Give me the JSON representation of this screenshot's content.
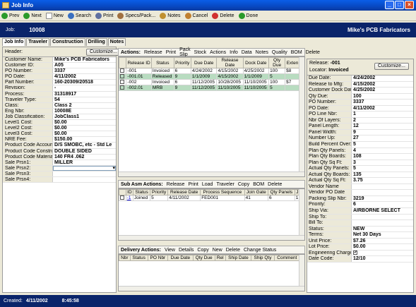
{
  "window": {
    "title": "Job Info"
  },
  "toolbar": [
    {
      "label": "Prev",
      "icon": "prev-icon",
      "color": "#2a9a2a"
    },
    {
      "label": "Next",
      "icon": "next-icon",
      "color": "#2a9a2a"
    },
    {
      "label": "New",
      "icon": "new-icon",
      "color": "#ffffff"
    },
    {
      "label": "Search",
      "icon": "search-icon",
      "color": "#3a70c0"
    },
    {
      "label": "Print",
      "icon": "print-icon",
      "color": "#6070a0"
    },
    {
      "label": "Specs/Pack...",
      "icon": "specs-icon",
      "color": "#a07040"
    },
    {
      "label": "Notes",
      "icon": "notes-icon",
      "color": "#c09030"
    },
    {
      "label": "Cancel",
      "icon": "cancel-icon",
      "color": "#c08030"
    },
    {
      "label": "Delete",
      "icon": "delete-icon",
      "color": "#d03030"
    },
    {
      "label": "Done",
      "icon": "done-icon",
      "color": "#2a9a2a"
    }
  ],
  "job": {
    "label": "Job:",
    "number": "10008",
    "company": "Mike's PCB Fabricators"
  },
  "tabs": [
    "Job Info",
    "Traveler",
    "Construction",
    "Drilling",
    "Notes"
  ],
  "left": {
    "header_label": "Header:",
    "customize": "Customize...",
    "fields": [
      [
        "Customer Name:",
        "Mike's PCB Fabricators"
      ],
      [
        "Customer ID:",
        "A05"
      ],
      [
        "PO Number:",
        "3337"
      ],
      [
        "PO Date:",
        "4/11/2002"
      ],
      [
        "Part Number:",
        "160-20309/20518"
      ],
      [
        "Revision:",
        "-"
      ],
      [
        "Process:",
        "31318917"
      ],
      [
        "Traveler Type:",
        "54"
      ],
      [
        "Class:",
        "Class 2"
      ],
      [
        "Eng Nbr:",
        "10008E"
      ],
      [
        "Job Classification:",
        "JobClass1"
      ],
      [
        "Level1 Cost:",
        "$0.00"
      ],
      [
        "Level2 Cost:",
        "$0.00"
      ],
      [
        "Level3 Cost:",
        "$0.00"
      ],
      [
        "NRE Fee:",
        "$150.00"
      ],
      [
        "Product Code Account:",
        "D/S SMOBC, etc - Std Le"
      ],
      [
        "Product Code Construct...",
        "DOUBLE SIDED"
      ],
      [
        "Product Code Material:",
        "140 FR4 .062"
      ],
      [
        "Sale Prsn1:",
        "MILLER"
      ],
      [
        "Sale Prsn2:",
        ""
      ],
      [
        "Sale Prsn3:",
        ""
      ],
      [
        "Sale Prsn4:",
        ""
      ]
    ]
  },
  "release_actions": {
    "title": "Actions:",
    "items": [
      "Release",
      "Print",
      "Pack Slip",
      "Stock",
      "Actions",
      "Info",
      "Data",
      "Notes",
      "Quality",
      "BOM",
      "Delete"
    ]
  },
  "release_table": {
    "columns": [
      "",
      "Release ID",
      "Status",
      "Priority",
      "Due Date",
      "Release Date",
      "Dock Date",
      "Qty Due",
      "Exten"
    ],
    "rows": [
      {
        "hl": false,
        "cells": [
          "",
          "-001",
          "Invoiced",
          "6",
          "4/24/2002",
          "4/15/2002",
          "4/25/2002",
          "100",
          "$8"
        ]
      },
      {
        "hl": true,
        "cells": [
          "",
          "-001.01",
          "Released",
          "9",
          "1/1/2009",
          "4/15/2002",
          "1/1/2009",
          "5",
          ""
        ]
      },
      {
        "hl": false,
        "cells": [
          "",
          "-002",
          "Invoiced",
          "6",
          "11/12/2005",
          "10/28/2005",
          "11/10/2005",
          "100",
          "$7"
        ]
      },
      {
        "hl": true,
        "cells": [
          "",
          "-002.01",
          "MRB",
          "9",
          "11/12/2005",
          "11/10/2005",
          "11/10/2005",
          "5",
          ""
        ]
      }
    ]
  },
  "subasm_actions": {
    "title": "Sub Asm Actions:",
    "items": [
      "Release",
      "Print",
      "Load",
      "Traveler",
      "Copy",
      "BOM",
      "Delete"
    ]
  },
  "subasm_table": {
    "columns": [
      "",
      "ID",
      "Status",
      "Priority",
      "Release Date",
      "Process Sequence",
      "Join Gate",
      "Qty Panels",
      "J"
    ],
    "rows": [
      [
        "",
        "-1",
        "Joined",
        "5",
        "4/11/2002",
        "FED001",
        "41",
        "6",
        "1"
      ]
    ]
  },
  "delivery_actions": {
    "title": "Delivery Actions:",
    "items": [
      "View",
      "Details",
      "Copy",
      "New",
      "Delete",
      "Change Status"
    ]
  },
  "delivery_table": {
    "columns": [
      "Nbr",
      "Status",
      "PO Nbr",
      "Due Date",
      "Qty Due",
      "Rel",
      "Ship Date",
      "Ship Qty",
      "Comment"
    ]
  },
  "right": {
    "release_label": "Release:",
    "release_val": "-001",
    "locator_label": "Locator:",
    "locator_val": "Invoiced",
    "customize": "Customize...",
    "fields": [
      [
        "Due Date:",
        "4/24/2002"
      ],
      [
        "Release to Mfg:",
        "4/15/2002"
      ],
      [
        "Customer Dock Date:",
        "4/25/2002"
      ],
      [
        "Qty Due:",
        "100"
      ],
      [
        "PO Number:",
        "3337"
      ],
      [
        "PO Date:",
        "4/11/2002"
      ],
      [
        "PO Line Nbr:",
        "1"
      ],
      [
        "Nbr Of Layers:",
        "2"
      ],
      [
        "Panel Length:",
        "12"
      ],
      [
        "Panel Width:",
        "9"
      ],
      [
        "Number Up:",
        "27"
      ],
      [
        "Build Percent Over:",
        "5"
      ],
      [
        "Plan Qty Panels:",
        "4"
      ],
      [
        "Plan Qty Boards:",
        "108"
      ],
      [
        "Plan Qty Sq Ft:",
        "3"
      ],
      [
        "Actual Qty Panels:",
        "5"
      ],
      [
        "Actual Qty Boards:",
        "135"
      ],
      [
        "Actual Qty Sq Ft:",
        "3.75"
      ],
      [
        "Vendor Name",
        ""
      ],
      [
        "Vendor PO Date",
        ""
      ],
      [
        "Packing Slip Nbr:",
        "3219"
      ],
      [
        "Priority:",
        "6"
      ],
      [
        "Ship Via:",
        "AIRBORNE SELECT"
      ],
      [
        "Ship To:",
        ""
      ],
      [
        "Bill To:",
        ""
      ],
      [
        "Status:",
        "NEW"
      ],
      [
        "Terms:",
        "Net 30 Days"
      ],
      [
        "Unit Price:",
        "$7.26"
      ],
      [
        "Lot Price:",
        "$0.00"
      ],
      [
        "Engineering Charges:",
        "✓"
      ],
      [
        "Date Code:",
        "12/10"
      ]
    ]
  },
  "status": {
    "created_label": "Created:",
    "created_date": "4/11/2002",
    "created_time": "8:45:58"
  }
}
